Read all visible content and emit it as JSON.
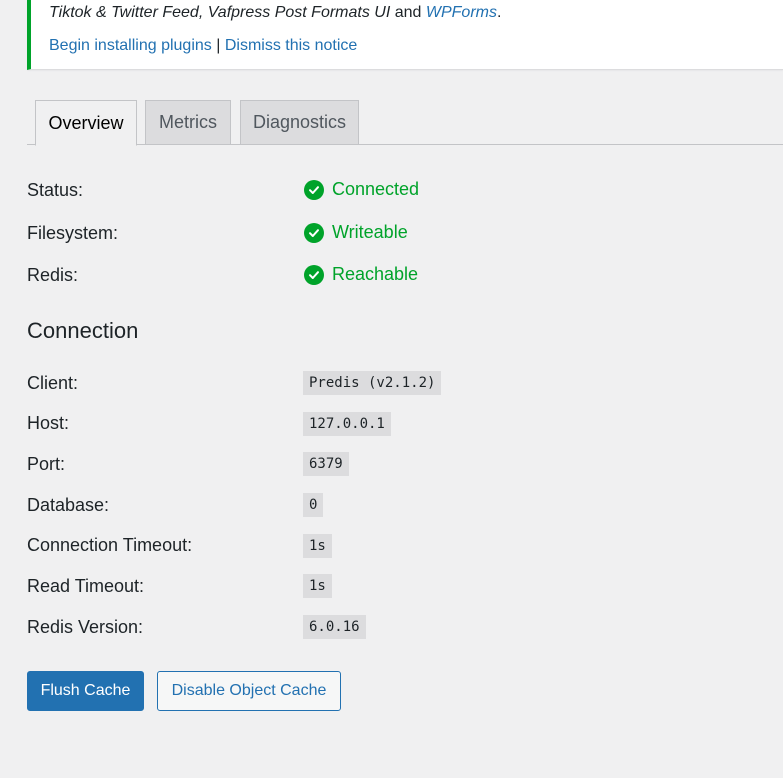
{
  "notice": {
    "text_italic": "Tiktok & Twitter Feed, Vafpress Post Formats UI",
    "text_and": " and ",
    "text_link": "WPForms",
    "text_period": ".",
    "link_install": "Begin installing plugins",
    "separator": " | ",
    "link_dismiss": "Dismiss this notice"
  },
  "tabs": [
    {
      "label": "Overview",
      "active": true
    },
    {
      "label": "Metrics",
      "active": false
    },
    {
      "label": "Diagnostics",
      "active": false
    }
  ],
  "status": [
    {
      "label": "Status:",
      "value": "Connected"
    },
    {
      "label": "Filesystem:",
      "value": "Writeable"
    },
    {
      "label": "Redis:",
      "value": "Reachable"
    }
  ],
  "connection": {
    "title": "Connection",
    "rows": [
      {
        "label": "Client:",
        "value": "Predis (v2.1.2)"
      },
      {
        "label": "Host:",
        "value": "127.0.0.1"
      },
      {
        "label": "Port:",
        "value": "6379"
      },
      {
        "label": "Database:",
        "value": "0"
      },
      {
        "label": "Connection Timeout:",
        "value": "1s"
      },
      {
        "label": "Read Timeout:",
        "value": "1s"
      },
      {
        "label": "Redis Version:",
        "value": "6.0.16"
      }
    ]
  },
  "buttons": {
    "flush": "Flush Cache",
    "disable": "Disable Object Cache"
  },
  "colors": {
    "success": "#00a32a",
    "link": "#2271b1",
    "background": "#f0f0f1"
  },
  "icons": {
    "status": "check-circle-icon"
  }
}
